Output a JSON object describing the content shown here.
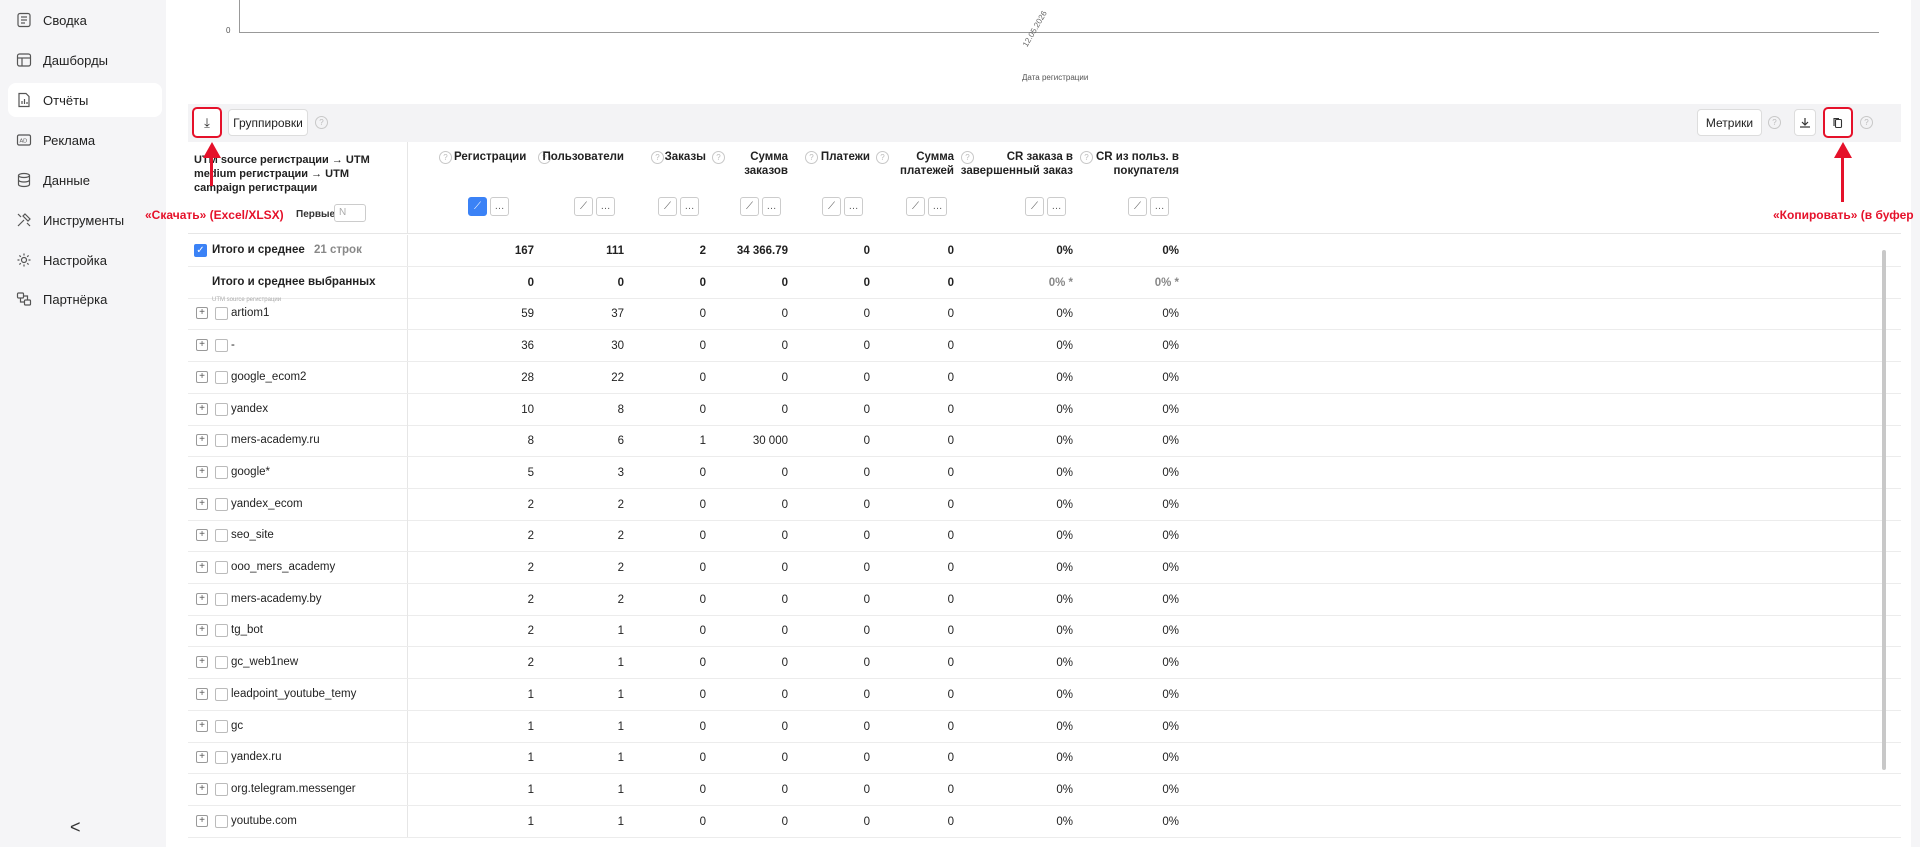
{
  "sidebar": {
    "items": [
      {
        "label": "Сводка",
        "icon": "summary-icon"
      },
      {
        "label": "Дашборды",
        "icon": "dashboard-icon"
      },
      {
        "label": "Отчёты",
        "icon": "reports-icon",
        "active": true
      },
      {
        "label": "Реклама",
        "icon": "ads-icon"
      },
      {
        "label": "Данные",
        "icon": "database-icon"
      },
      {
        "label": "Инструменты",
        "icon": "tools-icon"
      },
      {
        "label": "Настройка",
        "icon": "settings-icon"
      },
      {
        "label": "Партнёрка",
        "icon": "partner-icon"
      }
    ],
    "collapse_glyph": "<"
  },
  "chart": {
    "y_zero": "0",
    "x_tick": "12.05.2026",
    "x_label": "Дата регистрации"
  },
  "toolbar": {
    "download_glyph": "⤓",
    "groupings_label": "Группировки",
    "metrics_label": "Метрики"
  },
  "table": {
    "dimension_header": "UTM source регистрации → UTM medium регистрации → UTM campaign регистрации",
    "first_label": "Первые",
    "first_placeholder": "N",
    "columns": [
      "Регистрации",
      "Пользователи",
      "Заказы",
      "Сумма заказов",
      "Платежи",
      "Сумма платежей",
      "CR заказа в завершенный заказ",
      "CR из польз. в покупателя"
    ],
    "total": {
      "label": "Итого и среднее",
      "count": "21 строк",
      "values": [
        "167",
        "111",
        "2",
        "34 366.79",
        "0",
        "0",
        "0%",
        "0%"
      ]
    },
    "selected_total": {
      "label": "Итого и среднее выбранных",
      "values": [
        "0",
        "0",
        "0",
        "0",
        "0",
        "0",
        "0% *",
        "0% *"
      ]
    },
    "dim_caption": "UTM source регистрации",
    "rows": [
      {
        "name": "artiom1",
        "values": [
          "59",
          "37",
          "0",
          "0",
          "0",
          "0",
          "0%",
          "0%"
        ]
      },
      {
        "name": "-",
        "values": [
          "36",
          "30",
          "0",
          "0",
          "0",
          "0",
          "0%",
          "0%"
        ]
      },
      {
        "name": "google_ecom2",
        "values": [
          "28",
          "22",
          "0",
          "0",
          "0",
          "0",
          "0%",
          "0%"
        ]
      },
      {
        "name": "yandex",
        "values": [
          "10",
          "8",
          "0",
          "0",
          "0",
          "0",
          "0%",
          "0%"
        ]
      },
      {
        "name": "mers-academy.ru",
        "values": [
          "8",
          "6",
          "1",
          "30 000",
          "0",
          "0",
          "0%",
          "0%"
        ]
      },
      {
        "name": "google*",
        "values": [
          "5",
          "3",
          "0",
          "0",
          "0",
          "0",
          "0%",
          "0%"
        ]
      },
      {
        "name": "yandex_ecom",
        "values": [
          "2",
          "2",
          "0",
          "0",
          "0",
          "0",
          "0%",
          "0%"
        ]
      },
      {
        "name": "seo_site",
        "values": [
          "2",
          "2",
          "0",
          "0",
          "0",
          "0",
          "0%",
          "0%"
        ]
      },
      {
        "name": "ooo_mers_academy",
        "values": [
          "2",
          "2",
          "0",
          "0",
          "0",
          "0",
          "0%",
          "0%"
        ]
      },
      {
        "name": "mers-academy.by",
        "values": [
          "2",
          "2",
          "0",
          "0",
          "0",
          "0",
          "0%",
          "0%"
        ]
      },
      {
        "name": "tg_bot",
        "values": [
          "2",
          "1",
          "0",
          "0",
          "0",
          "0",
          "0%",
          "0%"
        ]
      },
      {
        "name": "gc_web1new",
        "values": [
          "2",
          "1",
          "0",
          "0",
          "0",
          "0",
          "0%",
          "0%"
        ]
      },
      {
        "name": "leadpoint_youtube_temy",
        "values": [
          "1",
          "1",
          "0",
          "0",
          "0",
          "0",
          "0%",
          "0%"
        ]
      },
      {
        "name": "gc",
        "values": [
          "1",
          "1",
          "0",
          "0",
          "0",
          "0",
          "0%",
          "0%"
        ]
      },
      {
        "name": "yandex.ru",
        "values": [
          "1",
          "1",
          "0",
          "0",
          "0",
          "0",
          "0%",
          "0%"
        ]
      },
      {
        "name": "org.telegram.messenger",
        "values": [
          "1",
          "1",
          "0",
          "0",
          "0",
          "0",
          "0%",
          "0%"
        ]
      },
      {
        "name": "youtube.com",
        "values": [
          "1",
          "1",
          "0",
          "0",
          "0",
          "0",
          "0%",
          "0%"
        ]
      }
    ]
  },
  "annotations": {
    "download": "«Скачать» (Excel/XLSX)",
    "copy": "«Копировать» (в буфер"
  },
  "colors": {
    "accent": "#3b82f6",
    "annotation": "#e5112a"
  }
}
